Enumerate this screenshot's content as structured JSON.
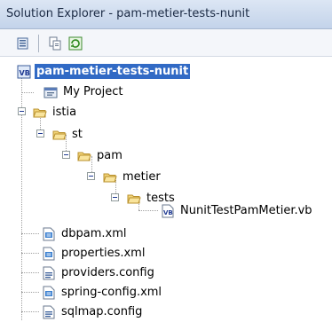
{
  "window": {
    "title": "Solution Explorer - pam-metier-tests-nunit"
  },
  "toolbar": {
    "buttons": [
      {
        "name": "properties-icon"
      },
      {
        "name": "show-all-files-icon"
      },
      {
        "name": "refresh-icon"
      }
    ]
  },
  "tree": {
    "project": "pam-metier-tests-nunit",
    "my_project": "My Project",
    "istia": "istia",
    "st": "st",
    "pam": "pam",
    "metier": "metier",
    "tests": "tests",
    "test_file": "NunitTestPamMetier.vb",
    "files": [
      "dbpam.xml",
      "properties.xml",
      "providers.config",
      "spring-config.xml",
      "sqlmap.config"
    ]
  },
  "colors": {
    "selection": "#316ac5",
    "titlebar": "#c3d3ea"
  }
}
